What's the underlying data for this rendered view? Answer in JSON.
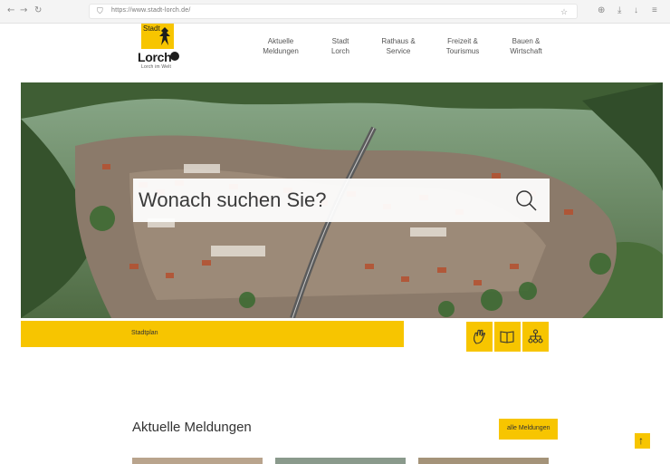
{
  "browser": {
    "url": "https://www.stadt-lorch.de/",
    "icons": [
      "back-icon",
      "forward-icon",
      "reload-icon",
      "shield-icon",
      "reader-icon",
      "bookmark-icon",
      "extensions-icon",
      "download-icon",
      "menu-icon"
    ]
  },
  "logo": {
    "stadt": "Stadt",
    "name": "Lorch",
    "sub": "Lorch im Welt"
  },
  "nav": {
    "items": [
      {
        "line1": "Aktuelle",
        "line2": "Meldungen"
      },
      {
        "line1": "Stadt",
        "line2": "Lorch"
      },
      {
        "line1": "Rathaus &",
        "line2": "Service"
      },
      {
        "line1": "Freizeit &",
        "line2": "Tourismus"
      },
      {
        "line1": "Bauen &",
        "line2": "Wirtschaft"
      }
    ]
  },
  "hero": {
    "search_placeholder": "Wonach suchen Sie?"
  },
  "quicklinks": {
    "stadtplan": "Stadtplan",
    "icons": [
      "hand-icon",
      "book-icon",
      "sitemap-icon"
    ]
  },
  "news": {
    "title": "Aktuelle Meldungen",
    "all_label": "alle Meldungen",
    "to_top": "↑"
  },
  "colors": {
    "accent": "#f7c500",
    "text": "#333333"
  }
}
